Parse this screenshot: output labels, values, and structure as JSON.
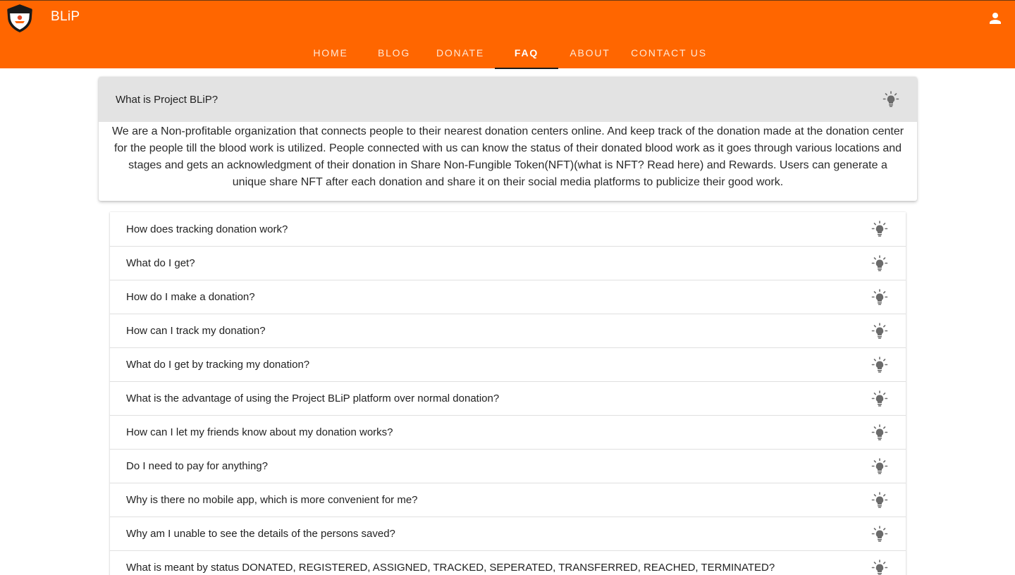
{
  "header": {
    "brand": "BLiP",
    "logo_icon": "shield-logo-icon",
    "user_icon": "account-person-icon",
    "accent_color": "#ff6600"
  },
  "nav": {
    "tabs": [
      {
        "label": "HOME",
        "active": false
      },
      {
        "label": "BLOG",
        "active": false
      },
      {
        "label": "DONATE",
        "active": false
      },
      {
        "label": "FAQ",
        "active": true
      },
      {
        "label": "ABOUT",
        "active": false
      },
      {
        "label": "CONTACT US",
        "active": false
      }
    ]
  },
  "faq": {
    "expanded": {
      "question": "What is Project BLiP?",
      "answer": "We are a Non-profitable organization that connects people to their nearest donation centers online. And keep track of the donation made at the donation center for the people till the blood work is utilized. People connected with us can know the status of their donated blood work as it goes through various locations and stages and gets an acknowledgment of their donation in Share Non-Fungible Token(NFT)(what is NFT? Read here) and Rewards. Users can generate a unique share NFT after each donation and share it on their social media platforms to publicize their good work."
    },
    "items": [
      "How does tracking donation work?",
      "What do I get?",
      "How do I make a donation?",
      "How can I track my donation?",
      "What do I get by tracking my donation?",
      "What is the advantage of using the Project BLiP platform over normal donation?",
      "How can I let my friends know about my donation works?",
      "Do I need to pay for anything?",
      "Why is there no mobile app, which is more convenient for me?",
      "Why am I unable to see the details of the persons saved?",
      "What is meant by status DONATED, REGISTERED, ASSIGNED, TRACKED, SEPERATED, TRANSFERRED, REACHED, TERMINATED?"
    ],
    "toggle_icon": "lightbulb-icon"
  }
}
